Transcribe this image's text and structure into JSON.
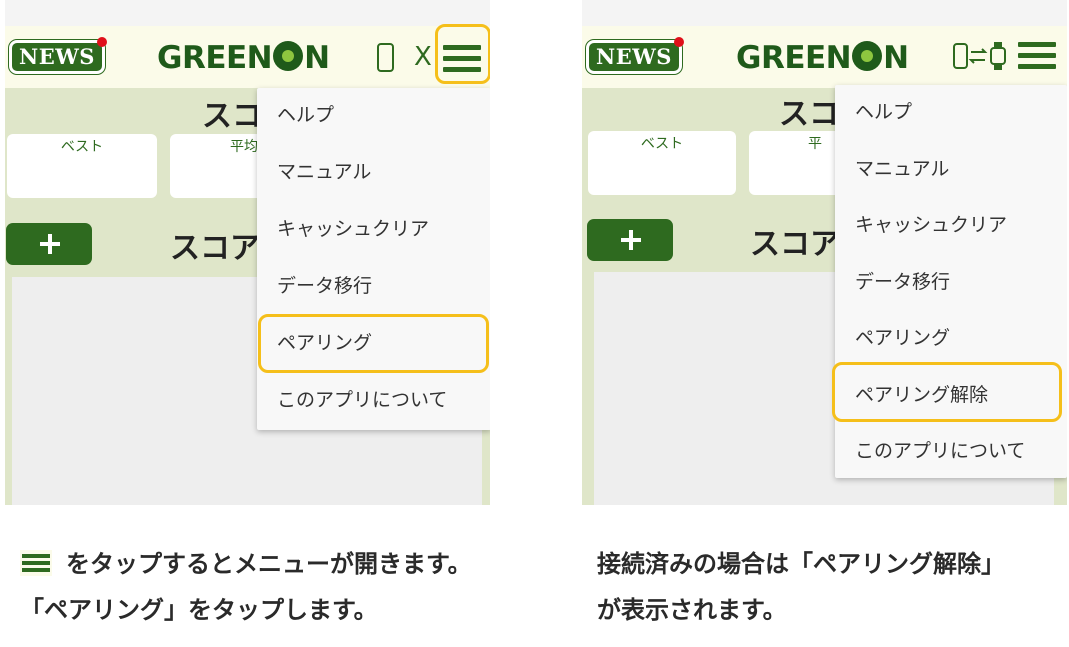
{
  "left_screen": {
    "header": {
      "news_logo": "NEWS",
      "brand_logo": [
        "GREEN",
        "N"
      ],
      "status_glyph": "X"
    },
    "page_title": "スコ",
    "score_cards": [
      {
        "label": "ベスト"
      },
      {
        "label": "平均"
      }
    ],
    "list_title": "スコア",
    "menu": [
      "ヘルプ",
      "マニュアル",
      "キャッシュクリア",
      "データ移行",
      "ペアリング",
      "このアプリについて"
    ],
    "highlighted_item": "ペアリング"
  },
  "right_screen": {
    "header": {
      "news_logo": "NEWS",
      "brand_logo": [
        "GREEN",
        "N"
      ],
      "connection_glyph": "⇄"
    },
    "page_title": "スコ",
    "score_cards": [
      {
        "label": "ベスト"
      },
      {
        "label": "平"
      }
    ],
    "list_title": "スコア",
    "menu": [
      "ヘルプ",
      "マニュアル",
      "キャッシュクリア",
      "データ移行",
      "ペアリング",
      "ペアリング解除",
      "このアプリについて"
    ],
    "highlighted_item": "ペアリング解除"
  },
  "captions": {
    "left": [
      "をタップするとメニューが開きます。",
      "「ペアリング」をタップします。"
    ],
    "right": [
      "接続済みの場合は「ペアリング解除」",
      "が表示されます。"
    ]
  },
  "colors": {
    "brand_green": "#2e6a1f",
    "highlight": "#f5bf1a",
    "header_bg": "#fbfbe9",
    "screen_bg": "#dfe6c9"
  }
}
